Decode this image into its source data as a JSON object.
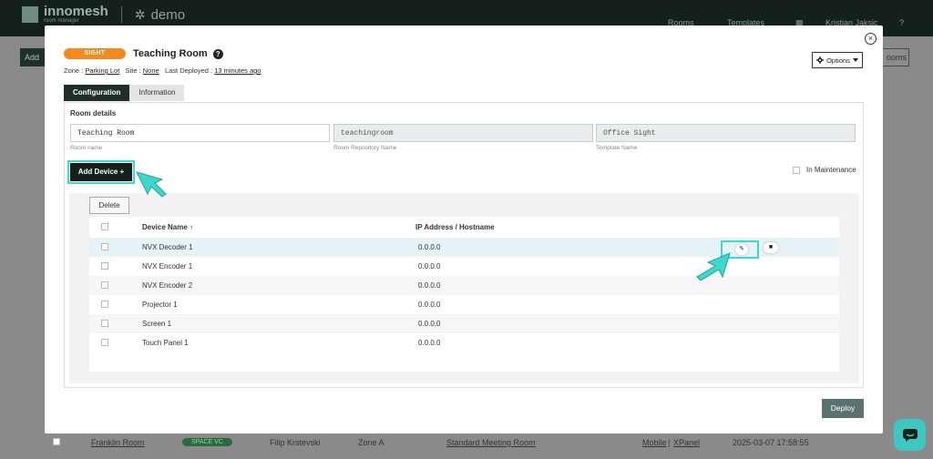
{
  "background": {
    "logo_name": "innomesh",
    "logo_sub": "room manager",
    "tenant": "demo",
    "nav": [
      "Rooms",
      "Templates"
    ],
    "user": "Kristian Jaksic",
    "add_label": "Add",
    "rooms_button": "ooms",
    "row": {
      "room": "Franklin Room",
      "badge": "SPACE VC",
      "owner": "Filip Krstevski",
      "zone": "Zone A",
      "template": "Standard Meeting Room",
      "links": [
        "Mobile",
        "XPanel"
      ],
      "link_sep": "|",
      "date": "2025-03-07 17:58:55"
    }
  },
  "modal": {
    "badge": "SIGHT",
    "title": "Teaching Room",
    "meta": {
      "zone_label": "Zone :",
      "zone_value": "Parking Lot",
      "site_label": "Site :",
      "site_value": "None",
      "deployed_label": "Last Deployed :",
      "deployed_value": "13 minutes ago"
    },
    "options_label": "Options",
    "tabs": [
      {
        "label": "Configuration",
        "active": true
      },
      {
        "label": "Information",
        "active": false
      }
    ],
    "room_details": {
      "heading": "Room details",
      "fields": [
        {
          "value": "Teaching Room",
          "caption": "Room name"
        },
        {
          "value": "teachingroom",
          "caption": "Room Repository Name"
        },
        {
          "value": "Office Sight",
          "caption": "Template Name"
        }
      ]
    },
    "add_device_label": "Add Device +",
    "maintenance_label": "In Maintenance",
    "devices": {
      "delete_label": "Delete",
      "columns": [
        "Device Name ↑",
        "IP Address / Hostname"
      ],
      "rows": [
        {
          "name": "NVX Decoder 1",
          "ip": "0.0.0.0"
        },
        {
          "name": "NVX Encoder 1",
          "ip": "0.0.0.0"
        },
        {
          "name": "NVX Encoder 2",
          "ip": "0.0.0.0"
        },
        {
          "name": "Projector 1",
          "ip": "0.0.0.0"
        },
        {
          "name": "Screen 1",
          "ip": "0.0.0.0"
        },
        {
          "name": "Touch Panel 1",
          "ip": "0.0.0.0"
        }
      ]
    },
    "deploy_label": "Deploy"
  },
  "colors": {
    "accent_highlight": "#3fd6cc",
    "badge_orange": "#f58b1e",
    "primary_dark": "#14201b",
    "deploy": "#5b7271"
  },
  "icons": {
    "close": "close-icon",
    "help": "help-icon",
    "options": "gear-icon",
    "edit": "pencil-icon",
    "delete": "trash-icon",
    "chat": "chat-icon"
  }
}
